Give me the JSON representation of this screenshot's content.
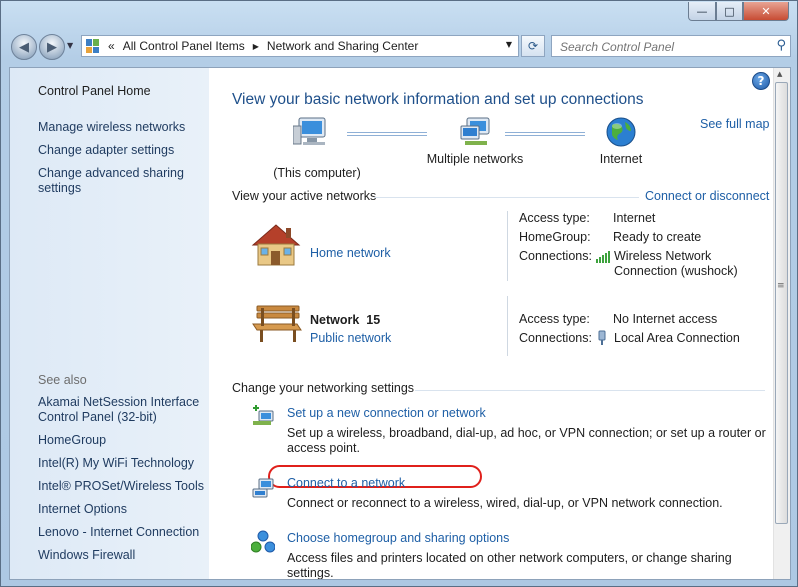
{
  "window": {
    "minimize": "—",
    "maximize": "□",
    "close": "✕"
  },
  "toolbar": {
    "chevron": "«",
    "breadcrumbs": [
      "All Control Panel Items",
      "Network and Sharing Center"
    ],
    "search_placeholder": "Search Control Panel"
  },
  "sidebar": {
    "home": "Control Panel Home",
    "links": [
      "Manage wireless networks",
      "Change adapter settings",
      "Change advanced sharing settings"
    ],
    "see_also_title": "See also",
    "see_also": [
      "Akamai NetSession Interface Control Panel (32-bit)",
      "HomeGroup",
      "Intel(R) My WiFi Technology",
      "Intel® PROSet/Wireless Tools",
      "Internet Options",
      "Lenovo - Internet Connection",
      "Windows Firewall"
    ]
  },
  "main": {
    "title": "View your basic network information and set up connections",
    "see_full_map": "See full map",
    "map_nodes": [
      "(This computer)",
      "Multiple networks",
      "Internet"
    ],
    "active_networks_title": "View your active networks",
    "connect_or_disconnect": "Connect or disconnect",
    "networks": [
      {
        "name": "",
        "category": "Home network",
        "access_type_label": "Access type:",
        "access_type": "Internet",
        "homegroup_label": "HomeGroup:",
        "homegroup": "Ready to create",
        "connections_label": "Connections:",
        "connection": "Wireless Network Connection (wushock)"
      },
      {
        "name": "Network  15",
        "category": "Public network",
        "access_type_label": "Access type:",
        "access_type": "No Internet access",
        "connections_label": "Connections:",
        "connection": "Local Area Connection"
      }
    ],
    "settings_title": "Change your networking settings",
    "tasks": [
      {
        "title": "Set up a new connection or network",
        "desc": "Set up a wireless, broadband, dial-up, ad hoc, or VPN connection; or set up a router or access point."
      },
      {
        "title": "Connect to a network",
        "desc": "Connect or reconnect to a wireless, wired, dial-up, or VPN network connection."
      },
      {
        "title": "Choose homegroup and sharing options",
        "desc": "Access files and printers located on other network computers, or change sharing settings."
      }
    ]
  },
  "colors": {
    "link": "#1e5fa6",
    "title": "#1e4f8a",
    "highlight_ring": "#e0201b",
    "sidebar_bg": "#dde9f6"
  },
  "icons": [
    "back-arrow-icon",
    "forward-arrow-icon",
    "control-panel-icon",
    "refresh-icon",
    "search-icon",
    "help-icon",
    "computer-icon",
    "network-icon",
    "globe-icon",
    "house-icon",
    "bench-icon",
    "wifi-signal-icon",
    "ethernet-icon",
    "new-connection-icon",
    "connect-network-icon",
    "homegroup-icon"
  ]
}
